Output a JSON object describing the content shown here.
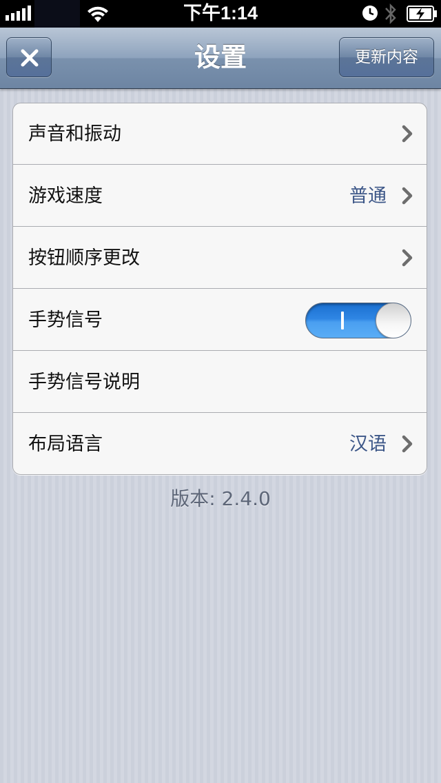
{
  "status_bar": {
    "time": "下午1:14",
    "icons": [
      "signal-icon",
      "wifi-icon",
      "clock-icon",
      "bluetooth-icon",
      "battery-icon"
    ]
  },
  "nav": {
    "title": "设置",
    "close_icon": "close-icon",
    "update_label": "更新内容"
  },
  "settings": {
    "rows": [
      {
        "label": "声音和振动",
        "value": "",
        "chevron": true
      },
      {
        "label": "游戏速度",
        "value": "普通",
        "chevron": true
      },
      {
        "label": "按钮顺序更改",
        "value": "",
        "chevron": true
      },
      {
        "label": "手势信号",
        "toggle": true,
        "toggle_on": true
      },
      {
        "label": "手势信号说明",
        "value": "",
        "chevron": false
      },
      {
        "label": "布局语言",
        "value": "汉语",
        "chevron": true
      }
    ]
  },
  "footer": {
    "version": "版本: 2.4.0"
  },
  "colors": {
    "value_text": "#3d5788",
    "toggle_on": "#2f86e4",
    "nav_bar": "#7a91ad"
  }
}
